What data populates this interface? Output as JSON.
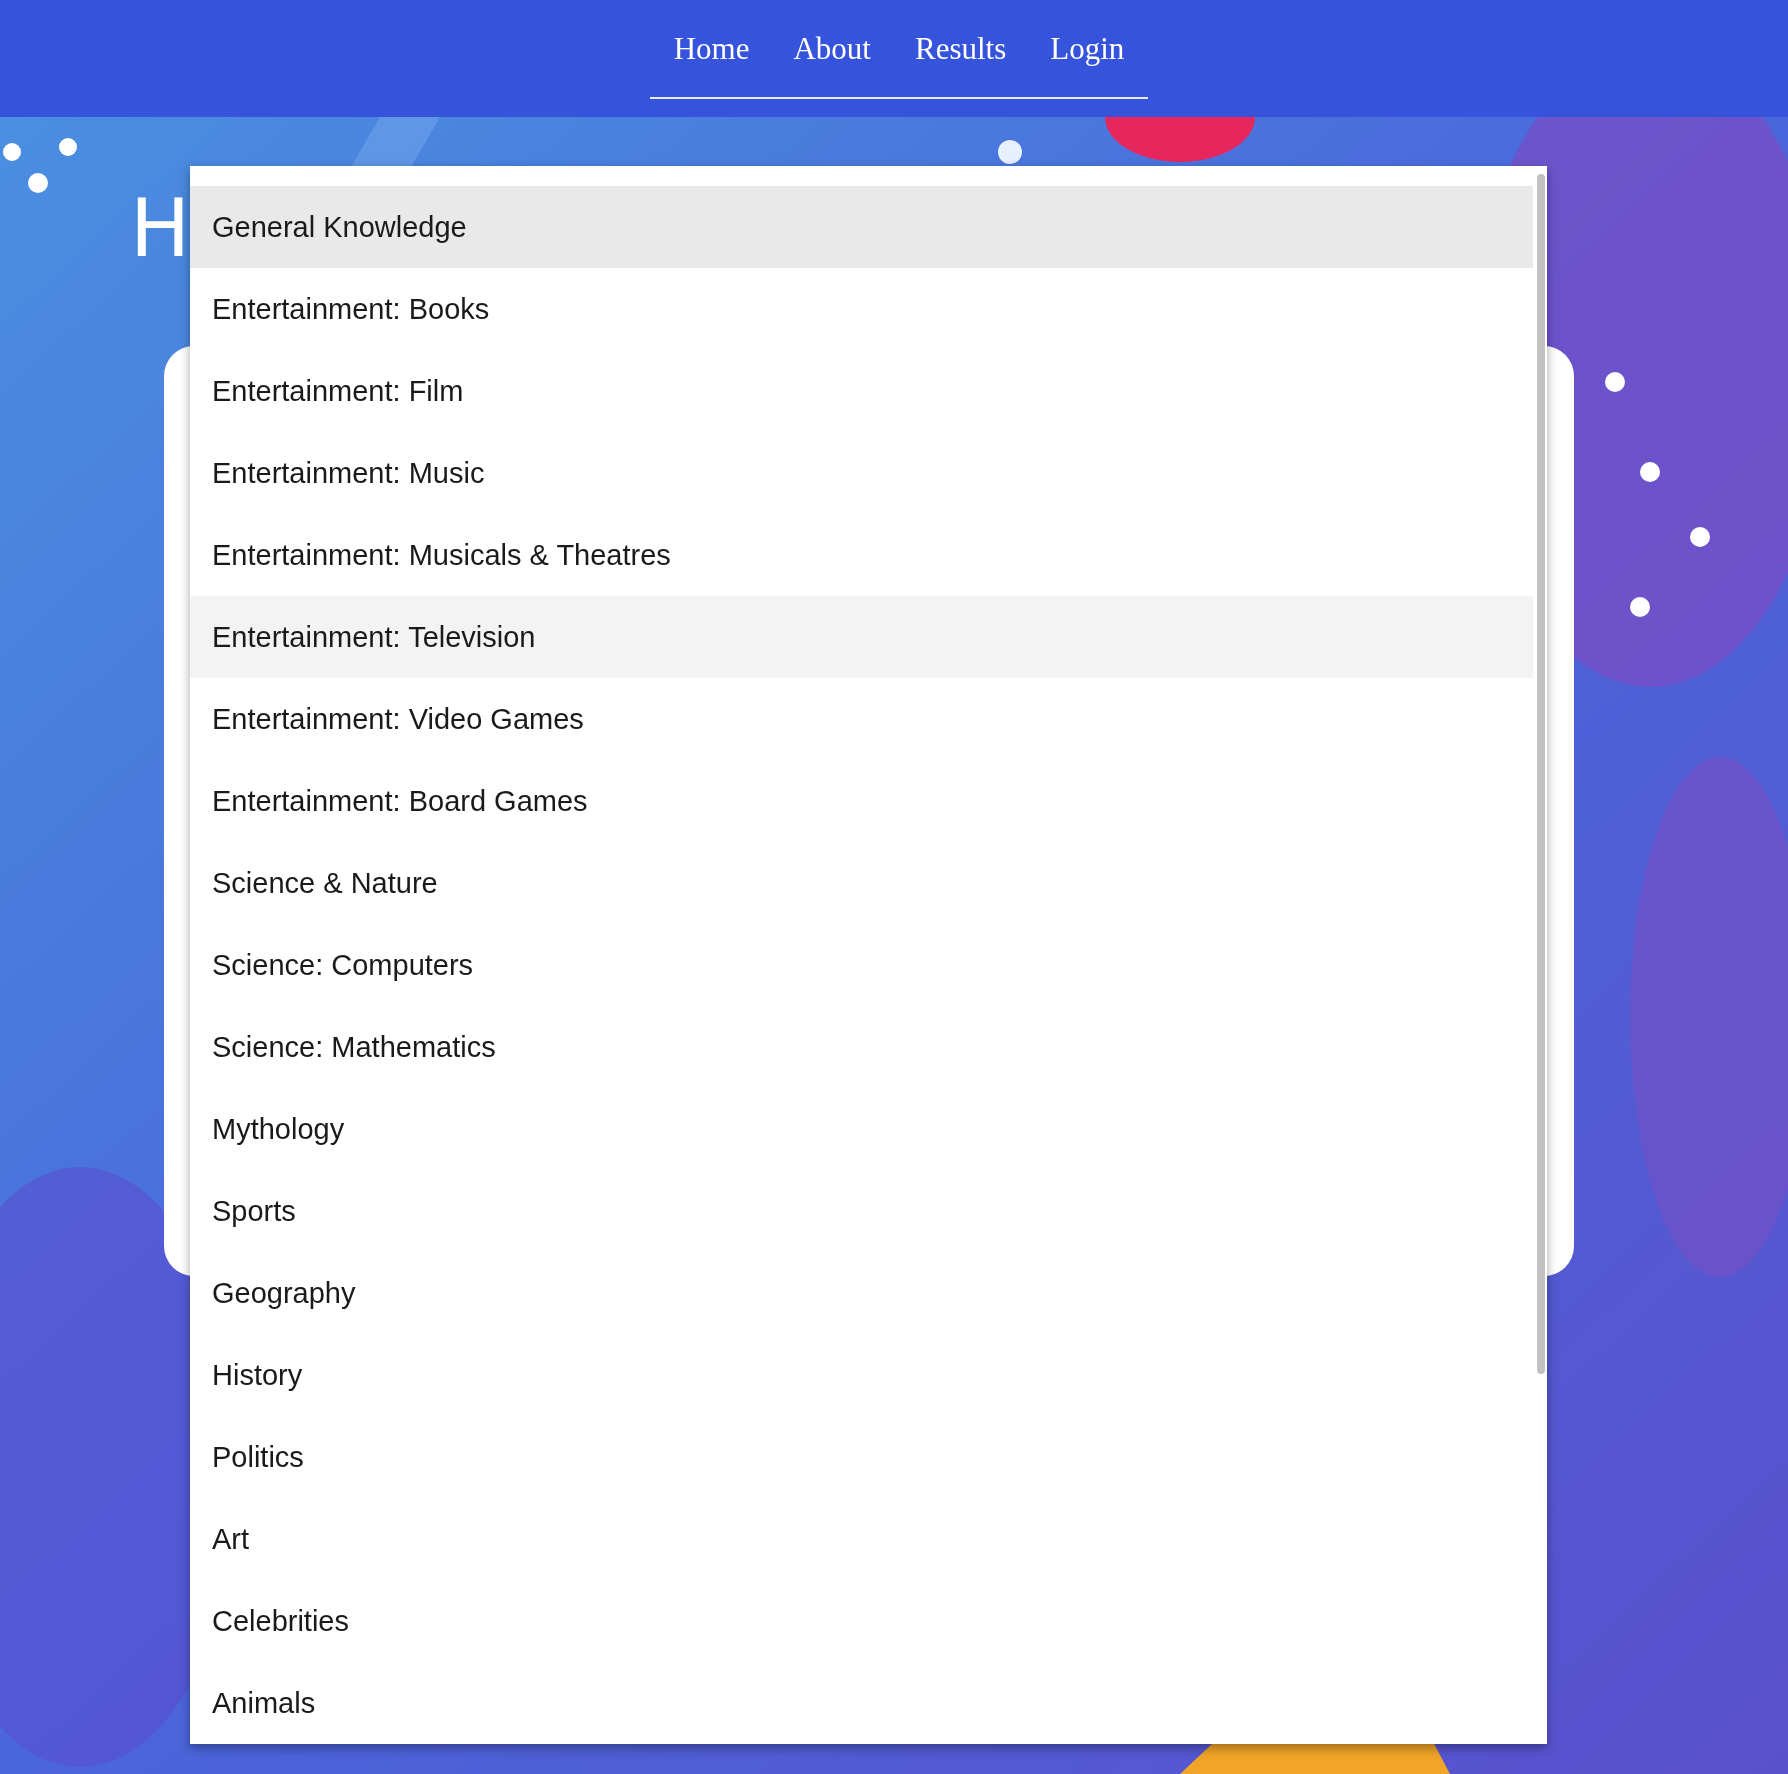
{
  "nav": {
    "links": [
      {
        "label": "Home"
      },
      {
        "label": "About"
      },
      {
        "label": "Results"
      },
      {
        "label": "Login"
      }
    ]
  },
  "page": {
    "title": "H"
  },
  "dropdown": {
    "options": [
      {
        "label": "General Knowledge",
        "selected": true,
        "hovered": false
      },
      {
        "label": "Entertainment: Books",
        "selected": false,
        "hovered": false
      },
      {
        "label": "Entertainment: Film",
        "selected": false,
        "hovered": false
      },
      {
        "label": "Entertainment: Music",
        "selected": false,
        "hovered": false
      },
      {
        "label": "Entertainment: Musicals & Theatres",
        "selected": false,
        "hovered": false
      },
      {
        "label": "Entertainment: Television",
        "selected": false,
        "hovered": true
      },
      {
        "label": "Entertainment: Video Games",
        "selected": false,
        "hovered": false
      },
      {
        "label": "Entertainment: Board Games",
        "selected": false,
        "hovered": false
      },
      {
        "label": "Science & Nature",
        "selected": false,
        "hovered": false
      },
      {
        "label": "Science: Computers",
        "selected": false,
        "hovered": false
      },
      {
        "label": "Science: Mathematics",
        "selected": false,
        "hovered": false
      },
      {
        "label": "Mythology",
        "selected": false,
        "hovered": false
      },
      {
        "label": "Sports",
        "selected": false,
        "hovered": false
      },
      {
        "label": "Geography",
        "selected": false,
        "hovered": false
      },
      {
        "label": "History",
        "selected": false,
        "hovered": false
      },
      {
        "label": "Politics",
        "selected": false,
        "hovered": false
      },
      {
        "label": "Art",
        "selected": false,
        "hovered": false
      },
      {
        "label": "Celebrities",
        "selected": false,
        "hovered": false
      },
      {
        "label": "Animals",
        "selected": false,
        "hovered": false
      }
    ]
  }
}
